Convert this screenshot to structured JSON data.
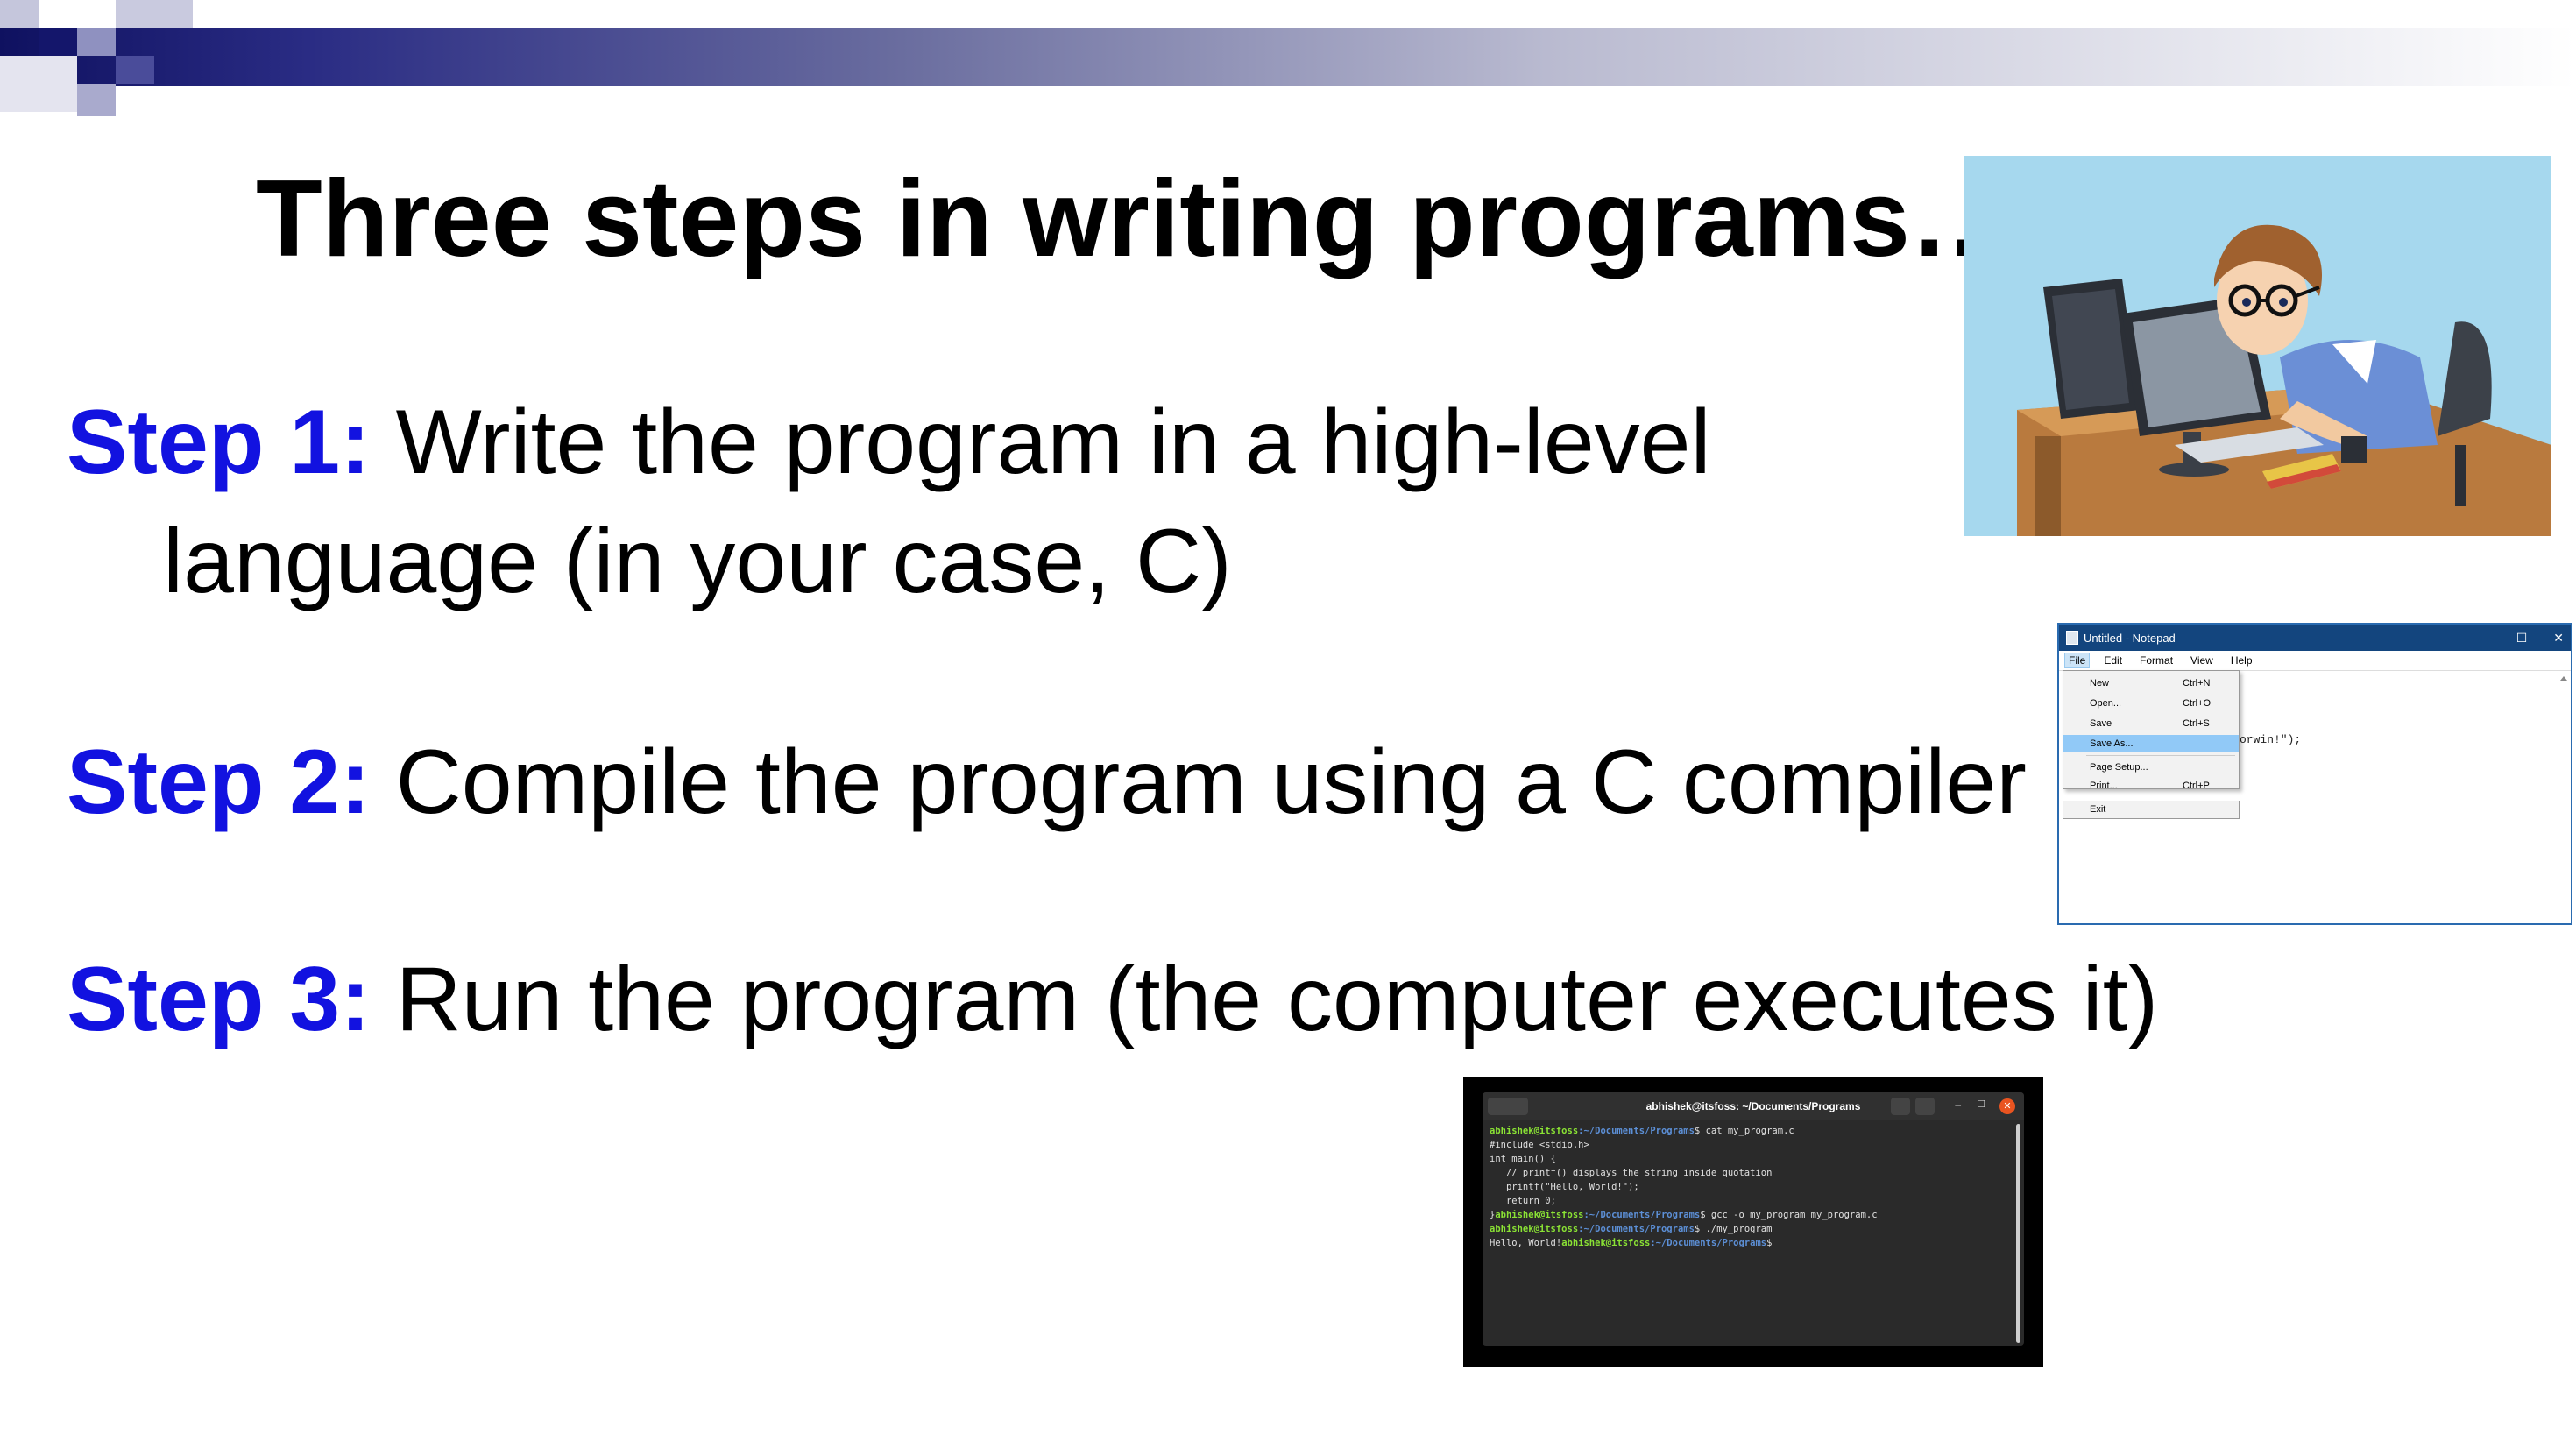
{
  "slide": {
    "title": "Three steps in writing programs…",
    "steps": [
      {
        "label": "Step 1:",
        "text_line1": " Write the program in a high-level",
        "text_line2": "language (in your case, C)"
      },
      {
        "label": "Step 2:",
        "text": " Compile the program using a C compiler"
      },
      {
        "label": "Step 3:",
        "text": " Run the program (the computer  executes it)"
      }
    ]
  },
  "notepad": {
    "window_title": "Untitled - Notepad",
    "menus": [
      "File",
      "Edit",
      "Format",
      "View",
      "Help"
    ],
    "file_menu_items": [
      {
        "label": "New",
        "shortcut": "Ctrl+N"
      },
      {
        "label": "Open...",
        "shortcut": "Ctrl+O"
      },
      {
        "label": "Save",
        "shortcut": "Ctrl+S"
      },
      {
        "label": "Save As...",
        "shortcut": ""
      },
      {
        "label": "Page Setup...",
        "shortcut": ""
      },
      {
        "label": "Print...",
        "shortcut": "Ctrl+P"
      },
      {
        "label": "Exit",
        "shortcut": ""
      }
    ],
    "visible_text": "orwin!\");"
  },
  "terminal": {
    "title": "abhishek@itsfoss: ~/Documents/Programs",
    "prompt_user": "abhishek@itsfoss",
    "prompt_path": ":~/Documents/Programs",
    "lines": [
      {
        "prompt": true,
        "cmd": "$ cat my_program.c"
      },
      {
        "prompt": false,
        "text": "#include <stdio.h>"
      },
      {
        "prompt": false,
        "text": "int main() {"
      },
      {
        "prompt": false,
        "text": "   // printf() displays the string inside quotation"
      },
      {
        "prompt": false,
        "text": "   printf(\"Hello, World!\");"
      },
      {
        "prompt": false,
        "text": "   return 0;"
      },
      {
        "prompt": true,
        "prefix": "}",
        "cmd": "$ gcc -o my_program my_program.c"
      },
      {
        "prompt": true,
        "cmd": "$ ./my_program"
      },
      {
        "prompt": true,
        "prefix": "Hello, World!",
        "cmd": "$"
      }
    ]
  },
  "colors": {
    "step_label": "#1212e0",
    "header_dark": "#0f1160",
    "header_square_mid": "#4a4c9a",
    "header_square_light": "#a9aacd",
    "illustration_bg": "#a6d8ee"
  }
}
